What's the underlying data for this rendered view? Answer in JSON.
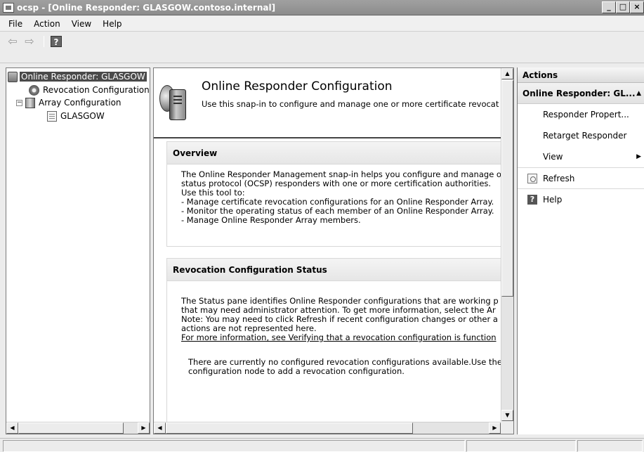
{
  "window": {
    "title": "ocsp - [Online Responder: GLASGOW.contoso.internal]",
    "min_label": "_",
    "max_label": "□",
    "close_label": "×"
  },
  "menu": [
    "File",
    "Action",
    "View",
    "Help"
  ],
  "toolbar": {
    "back_icon": "back-arrow-icon",
    "forward_icon": "forward-arrow-icon",
    "help_label": "?"
  },
  "tree": {
    "root": "Online Responder: GLASGOW",
    "revocation": "Revocation Configuration",
    "array": "Array Configuration",
    "member": "GLASGOW",
    "expander": "−"
  },
  "center": {
    "title": "Online Responder Configuration",
    "subtitle": "Use this snap-in to configure and manage one or more certificate revocat",
    "overview": {
      "heading": "Overview",
      "lines": [
        "The Online Responder Management snap-in helps you configure and manage o",
        "status protocol (OCSP) responders with one or more certification authorities.",
        "Use this tool to:",
        "- Manage certificate revocation configurations for an Online Responder Array.",
        "- Monitor the operating status of each member of an Online Responder Array.",
        "- Manage Online Responder Array members."
      ]
    },
    "status": {
      "heading": "Revocation Configuration Status",
      "lines": [
        "The Status pane identifies Online Responder configurations that are working p",
        "that may need administrator attention. To get more information, select the Ar",
        "Note: You may need to click Refresh if recent configuration changes or other a",
        "actions are not represented here."
      ],
      "link": "For more information, see Verifying that a revocation configuration is function",
      "empty_lines": [
        "There are currently no configured revocation configurations available.Use the",
        "configuration node to add a revocation configuration."
      ]
    }
  },
  "actions": {
    "heading": "Actions",
    "group": "Online Responder: GL...",
    "items": [
      {
        "label": "Responder Propert...",
        "icon": ""
      },
      {
        "label": "Retarget Responder",
        "icon": ""
      },
      {
        "label": "View",
        "icon": "",
        "submenu": "▶"
      },
      {
        "label": "Refresh",
        "icon": "refresh-icon"
      },
      {
        "label": "Help",
        "icon": "help-icon"
      }
    ],
    "collapse_caret": "▲"
  },
  "scroll": {
    "left": "◀",
    "right": "▶",
    "up": "▲",
    "down": "▼"
  },
  "colors": {
    "titlebar": "#8c8c8c",
    "selection": "#4a4a4a",
    "pane_border": "#7a7a7a"
  }
}
